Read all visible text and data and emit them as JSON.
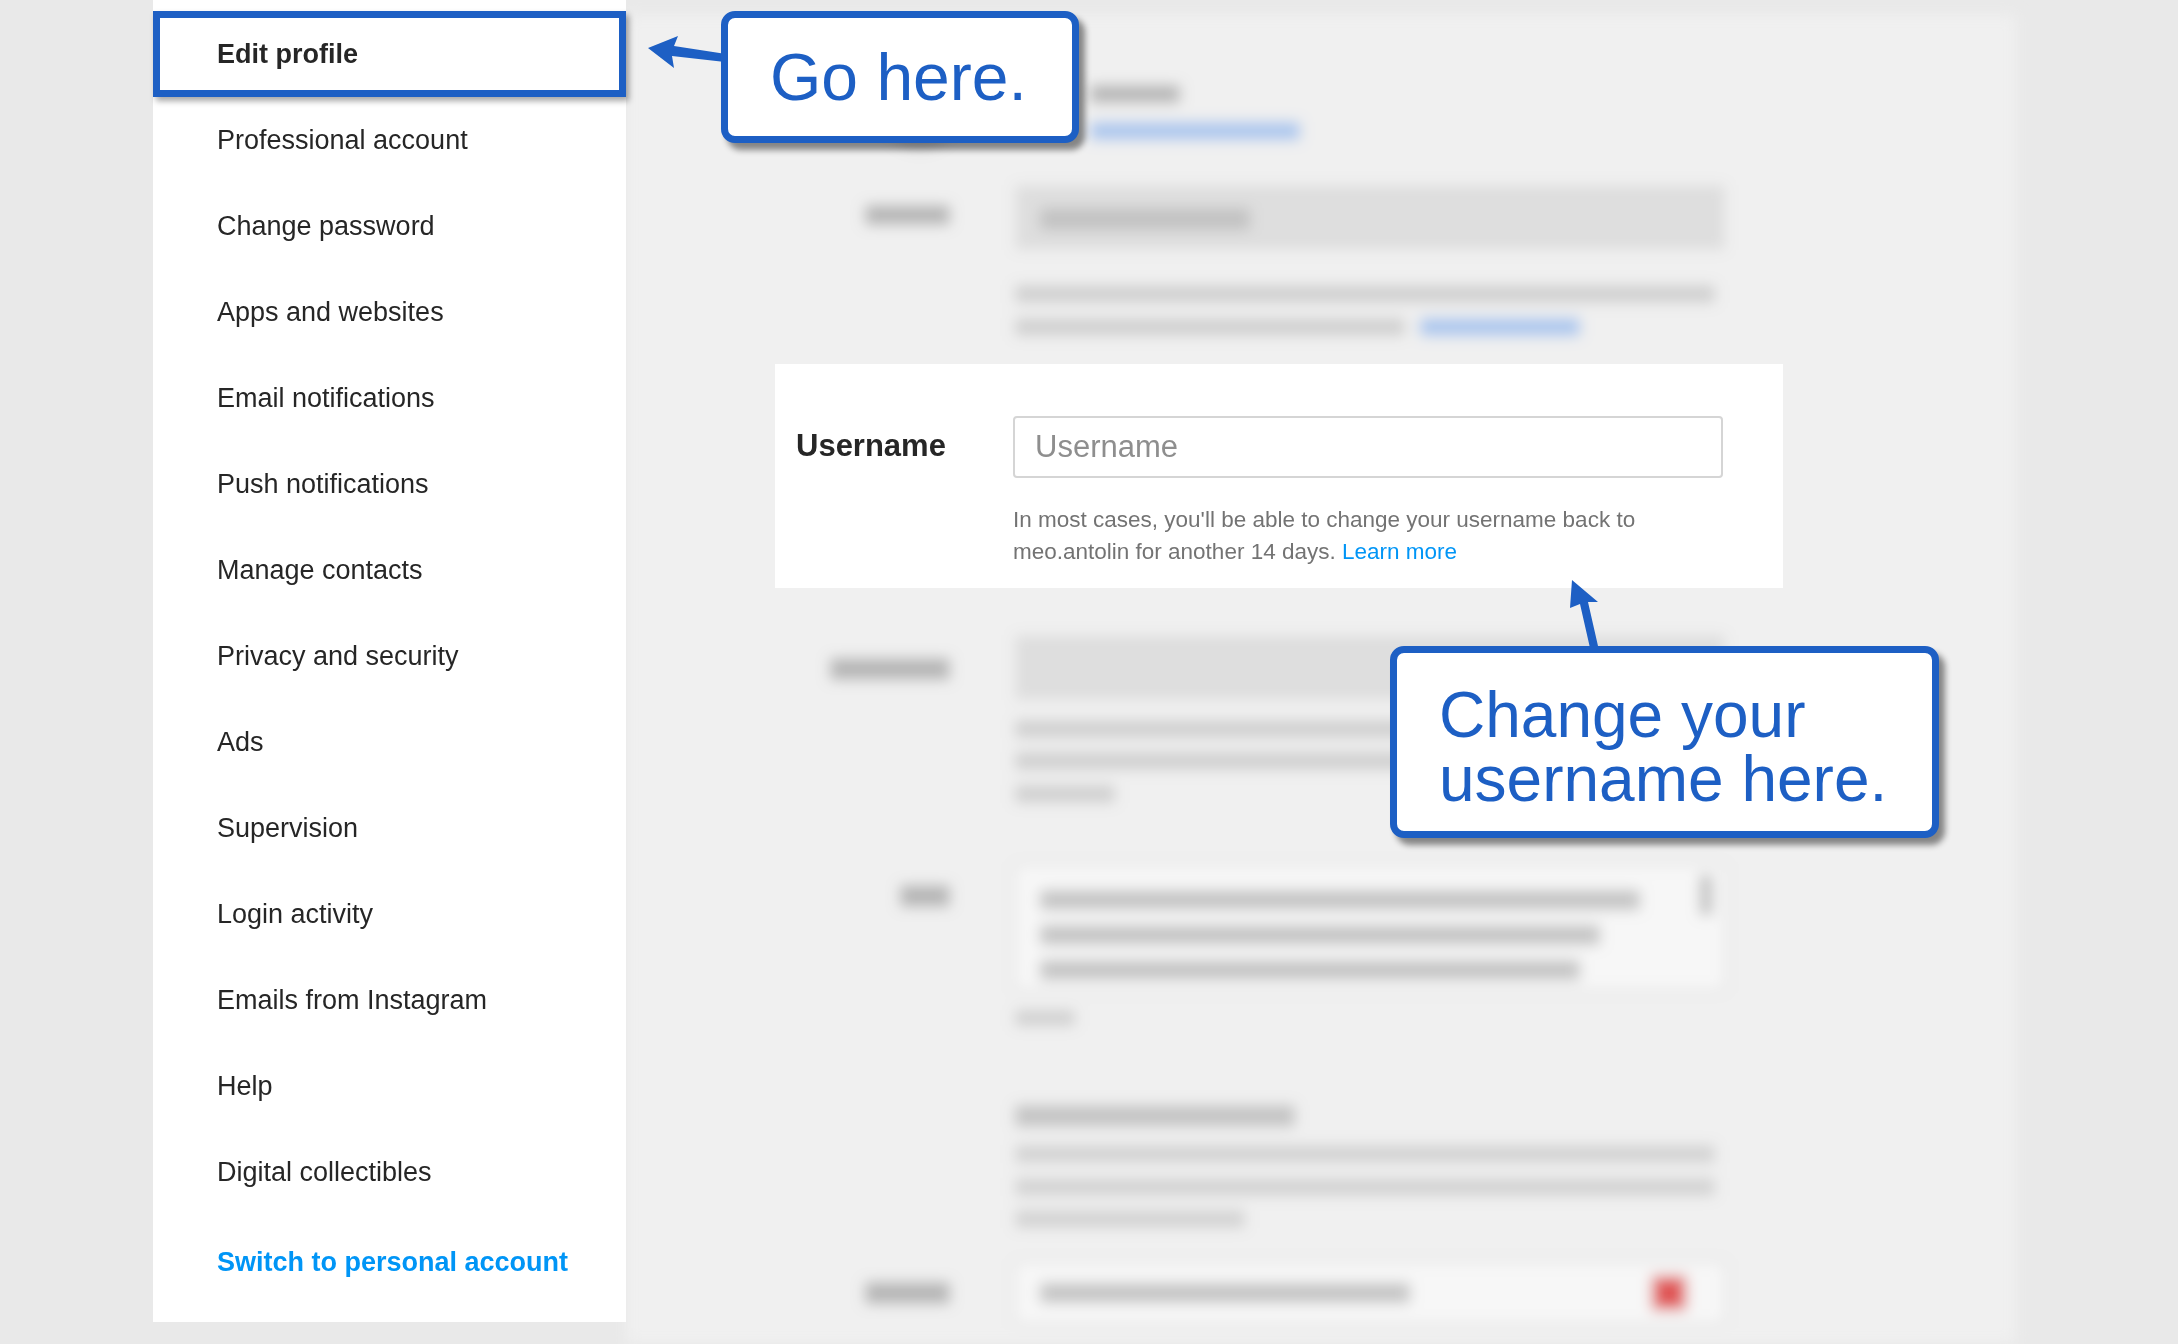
{
  "sidebar": {
    "items": [
      {
        "label": "Edit profile",
        "selected": true
      },
      {
        "label": "Professional account",
        "selected": false
      },
      {
        "label": "Change password",
        "selected": false
      },
      {
        "label": "Apps and websites",
        "selected": false
      },
      {
        "label": "Email notifications",
        "selected": false
      },
      {
        "label": "Push notifications",
        "selected": false
      },
      {
        "label": "Manage contacts",
        "selected": false
      },
      {
        "label": "Privacy and security",
        "selected": false
      },
      {
        "label": "Ads",
        "selected": false
      },
      {
        "label": "Supervision",
        "selected": false
      },
      {
        "label": "Login activity",
        "selected": false
      },
      {
        "label": "Emails from Instagram",
        "selected": false
      },
      {
        "label": "Help",
        "selected": false
      },
      {
        "label": "Digital collectibles",
        "selected": false
      }
    ],
    "switch_link": "Switch to personal account"
  },
  "username_panel": {
    "label": "Username",
    "placeholder": "Username",
    "help": "In most cases, you'll be able to change your username back to meo.antolin for another 14 days.",
    "learn_more": "Learn more"
  },
  "callouts": [
    {
      "text": "Go here."
    },
    {
      "text": "Change your username here."
    }
  ]
}
